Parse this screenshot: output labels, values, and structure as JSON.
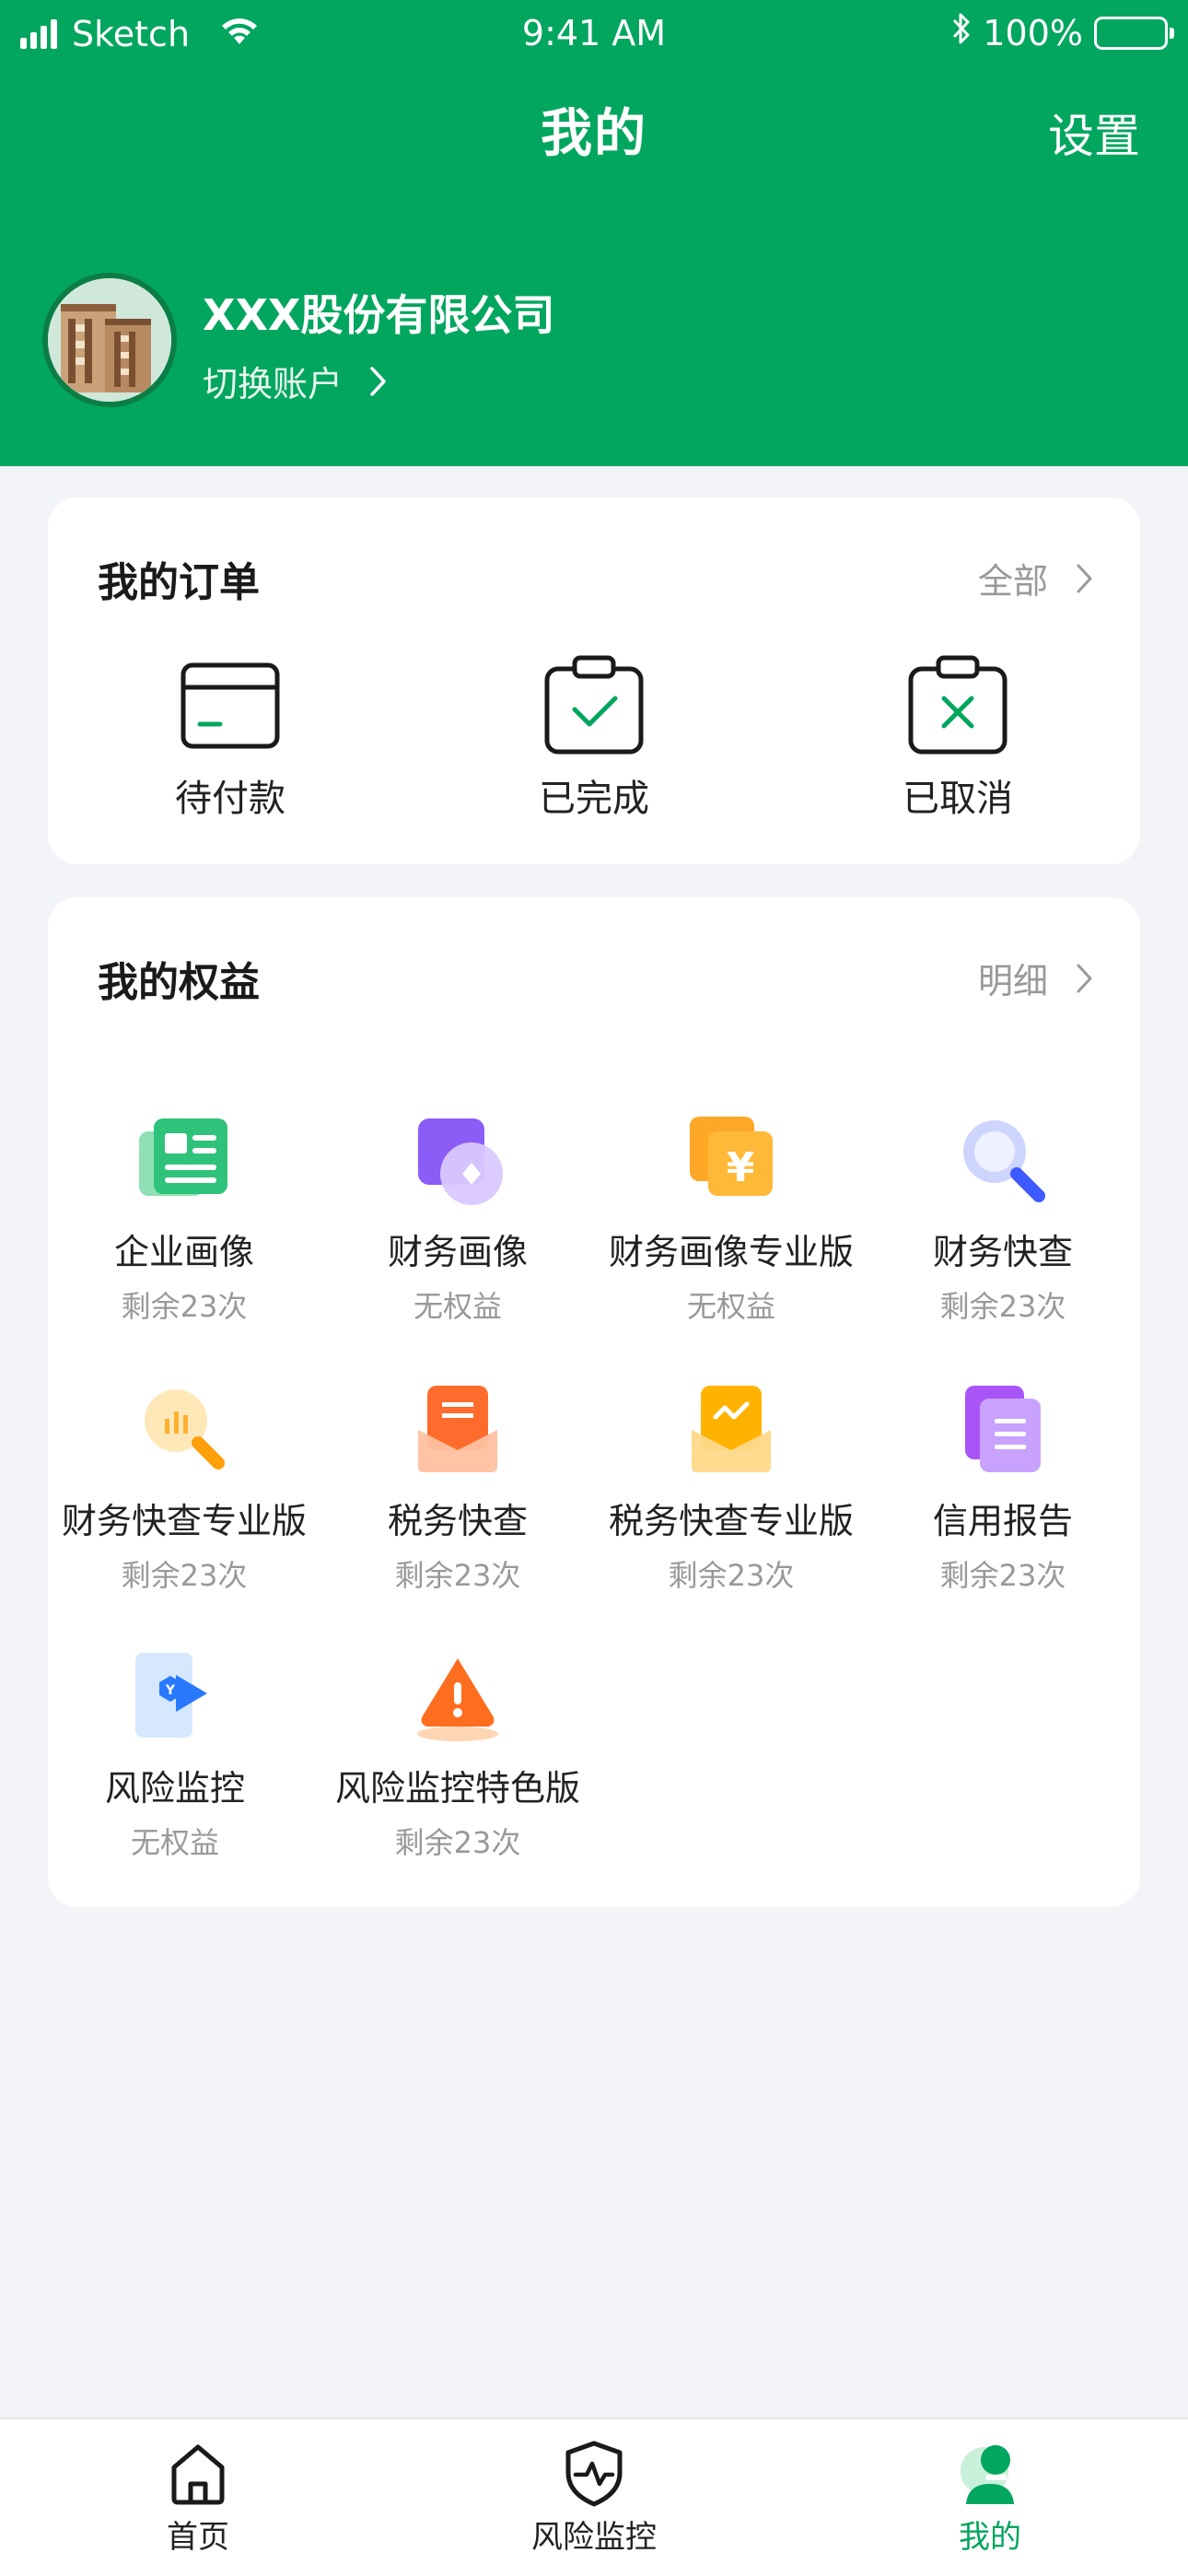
{
  "status_bar": {
    "carrier": "Sketch",
    "time": "9:41 AM",
    "battery": "100%"
  },
  "header": {
    "title": "我的",
    "settings_label": "设置"
  },
  "account": {
    "company_name": "XXX股份有限公司",
    "switch_label": "切换账户"
  },
  "orders": {
    "title": "我的订单",
    "more_label": "全部",
    "items": [
      {
        "label": "待付款",
        "icon": "wallet-icon"
      },
      {
        "label": "已完成",
        "icon": "clipboard-check-icon"
      },
      {
        "label": "已取消",
        "icon": "clipboard-cross-icon"
      }
    ]
  },
  "rights": {
    "title": "我的权益",
    "more_label": "明细",
    "items": [
      {
        "name": "企业画像",
        "sub": "剩余23次",
        "icon": "enterprise-profile-icon"
      },
      {
        "name": "财务画像",
        "sub": "无权益",
        "icon": "finance-profile-icon"
      },
      {
        "name": "财务画像专业版",
        "sub": "无权益",
        "icon": "finance-profile-pro-icon"
      },
      {
        "name": "财务快查",
        "sub": "剩余23次",
        "icon": "finance-quick-search-icon"
      },
      {
        "name": "财务快查专业版",
        "sub": "剩余23次",
        "icon": "finance-quick-search-pro-icon"
      },
      {
        "name": "税务快查",
        "sub": "剩余23次",
        "icon": "tax-quick-search-icon"
      },
      {
        "name": "税务快查专业版",
        "sub": "剩余23次",
        "icon": "tax-quick-search-pro-icon"
      },
      {
        "name": "信用报告",
        "sub": "剩余23次",
        "icon": "credit-report-icon"
      },
      {
        "name": "风险监控",
        "sub": "无权益",
        "icon": "risk-monitor-icon"
      },
      {
        "name": "风险监控特色版",
        "sub": "剩余23次",
        "icon": "risk-monitor-special-icon"
      }
    ]
  },
  "tabbar": {
    "items": [
      {
        "label": "首页",
        "icon": "home-icon",
        "active": false
      },
      {
        "label": "风险监控",
        "icon": "shield-pulse-icon",
        "active": false
      },
      {
        "label": "我的",
        "icon": "user-icon",
        "active": true
      }
    ]
  },
  "colors": {
    "brand": "#02a65e",
    "background": "#f3f4f8",
    "muted_text": "#999999"
  }
}
